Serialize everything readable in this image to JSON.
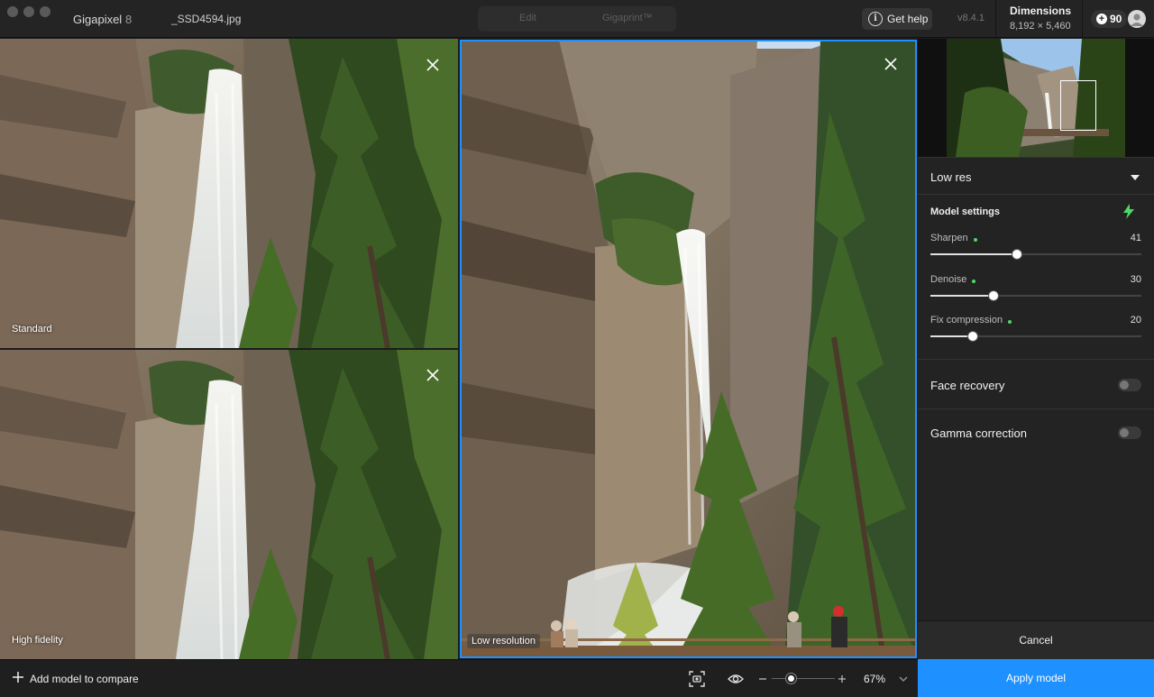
{
  "titlebar": {
    "app_name": "Gigapixel",
    "app_version": "8",
    "filename": "_SSD4594.jpg",
    "mode_tabs": [
      "Edit",
      "Gigaprint™"
    ],
    "help_label": "Get help",
    "version": "v8.4.1",
    "dimensions_label": "Dimensions",
    "dimensions_value": "8,192 × 5,460",
    "credits": "90"
  },
  "previews": [
    {
      "label": "Standard"
    },
    {
      "label": "High fidelity"
    },
    {
      "label": "Low resolution"
    }
  ],
  "sidebar": {
    "model_dropdown": "Low res",
    "model_settings_title": "Model settings",
    "sliders": [
      {
        "label": "Sharpen",
        "value": "41",
        "fraction": 0.41
      },
      {
        "label": "Denoise",
        "value": "30",
        "fraction": 0.3
      },
      {
        "label": "Fix compression",
        "value": "20",
        "fraction": 0.2
      }
    ],
    "toggles": [
      {
        "label": "Face recovery",
        "on": false
      },
      {
        "label": "Gamma correction",
        "on": false
      }
    ],
    "cancel_label": "Cancel",
    "apply_label": "Apply model"
  },
  "bottombar": {
    "add_model_label": "Add model to compare",
    "zoom_value": "67%",
    "zoom_fraction": 0.3
  },
  "colors": {
    "accent": "#1e90ff",
    "ready_dot": "#4cd964",
    "bolt": "#4cd964"
  }
}
